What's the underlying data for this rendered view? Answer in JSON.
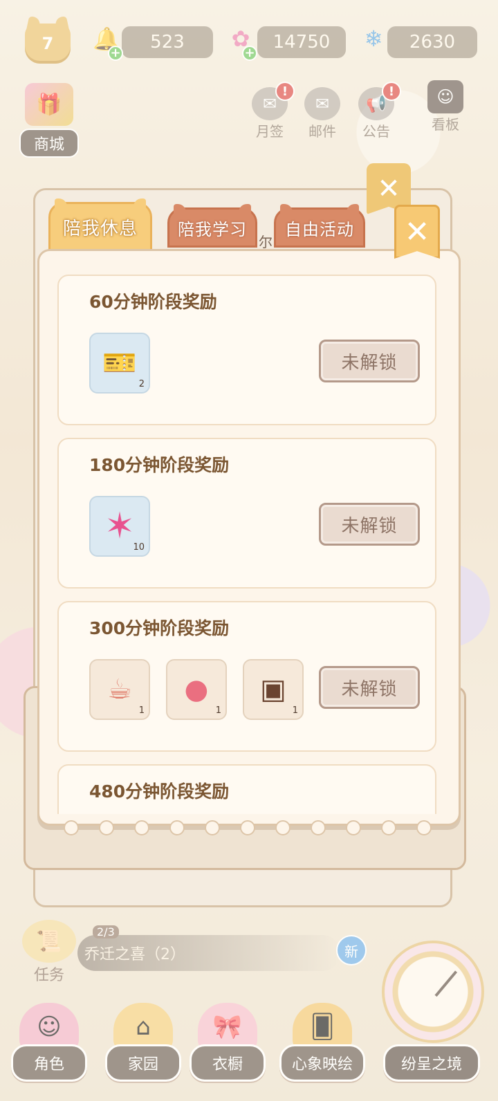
{
  "status_bar": {
    "level": "7",
    "bells": "523",
    "flowers": "14750",
    "snowflakes": "2630"
  },
  "top_buttons": {
    "shop": "商城",
    "monthly_sign": "月签",
    "mail": "邮件",
    "notice": "公告",
    "board": "看板",
    "alert_mark": "!"
  },
  "dialog": {
    "tabs": [
      "陪我休息",
      "陪我学习",
      "自由活动"
    ],
    "obscured_text": "尔",
    "close_symbol": "✕",
    "rewards": [
      {
        "title": "60分钟阶段奖励",
        "items": [
          {
            "icon": "ticket-icon",
            "qty": "2"
          }
        ],
        "button": "未解锁"
      },
      {
        "title": "180分钟阶段奖励",
        "items": [
          {
            "icon": "pink-star-crystal-icon",
            "qty": "10"
          }
        ],
        "button": "未解锁"
      },
      {
        "title": "300分钟阶段奖励",
        "items": [
          {
            "icon": "mug-icon",
            "qty": "1"
          },
          {
            "icon": "yarn-ball-icon",
            "qty": "1"
          },
          {
            "icon": "chalkboard-icon",
            "qty": "1"
          }
        ],
        "button": "未解锁"
      },
      {
        "title": "480分钟阶段奖励",
        "items": [],
        "button": ""
      }
    ]
  },
  "task_bar": {
    "label": "任务",
    "progress": "2/3",
    "task_name": "乔迁之喜（2）",
    "new_badge": "新"
  },
  "bottom_nav": [
    "角色",
    "家园",
    "衣橱",
    "心象映绘",
    "纷呈之境"
  ]
}
